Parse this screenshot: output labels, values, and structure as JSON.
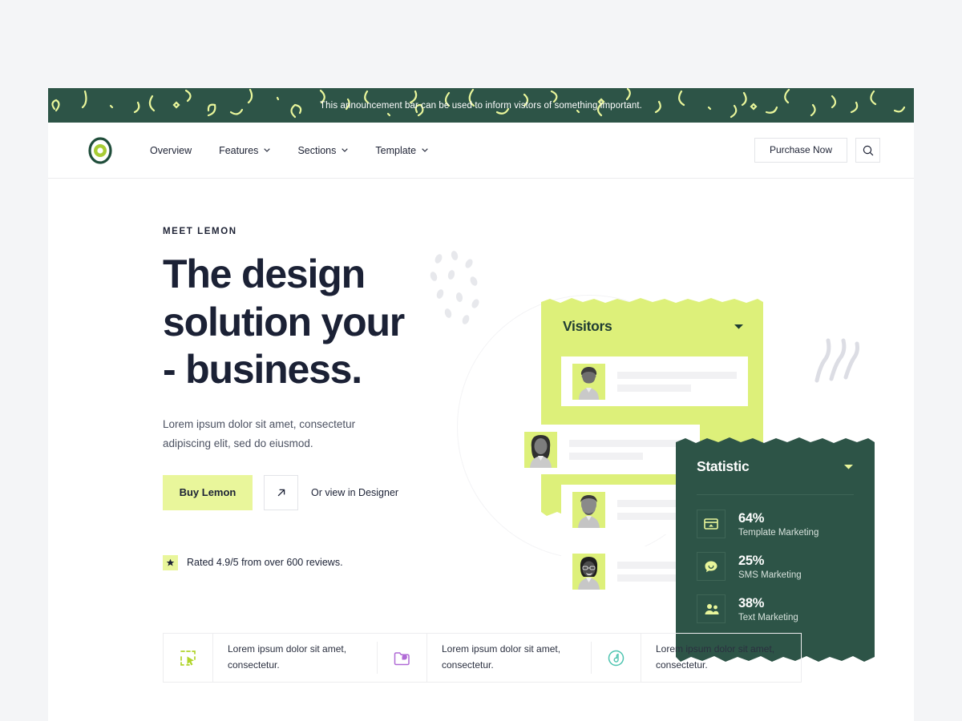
{
  "announcement": {
    "text": "This announcement bar can be used to inform vistors of something important."
  },
  "nav": {
    "logo_icon": "lemon-circle-logo",
    "links": [
      {
        "label": "Overview",
        "has_chevron": false
      },
      {
        "label": "Features",
        "has_chevron": true
      },
      {
        "label": "Sections",
        "has_chevron": true
      },
      {
        "label": "Template",
        "has_chevron": true
      }
    ],
    "purchase_label": "Purchase Now",
    "search_icon": "search-icon"
  },
  "hero": {
    "eyebrow": "MEET LEMON",
    "headline_line1": "The design",
    "headline_line2": "solution your",
    "headline_line3": "- business.",
    "subtext": "Lorem ipsum dolor sit amet, consectetur adipiscing elit, sed do eiusmod.",
    "buy_label": "Buy Lemon",
    "arrow_icon": "arrow-up-right-icon",
    "designer_link": "Or view in Designer",
    "star_icon": "star-icon",
    "rating_text": "Rated 4.9/5 from over 600 reviews."
  },
  "visitors_card": {
    "title": "Visitors",
    "chevron_icon": "chevron-down-icon",
    "rows": [
      {
        "avatar": "portrait-person-1"
      },
      {
        "avatar": "portrait-person-2"
      },
      {
        "avatar": "portrait-person-3"
      },
      {
        "avatar": "portrait-person-4"
      }
    ]
  },
  "statistic_card": {
    "title": "Statistic",
    "chevron_icon": "chevron-down-icon",
    "items": [
      {
        "percent": "64%",
        "label": "Template Marketing",
        "icon": "browser-window-icon"
      },
      {
        "percent": "25%",
        "label": "SMS Marketing",
        "icon": "chat-bubble-icon"
      },
      {
        "percent": "38%",
        "label": "Text Marketing",
        "icon": "users-group-icon"
      }
    ]
  },
  "features": [
    {
      "icon": "selection-cursor-icon",
      "text": "Lorem ipsum dolor sit amet, consectetur."
    },
    {
      "icon": "folder-icon",
      "text": "Lorem ipsum dolor sit amet, consectetur."
    },
    {
      "icon": "gauge-icon",
      "text": "Lorem ipsum dolor sit amet, consectetur."
    }
  ],
  "colors": {
    "dark_green": "#2d5447",
    "lime": "#ddf07a",
    "lime_light": "#e9f69b",
    "navy": "#1b2135",
    "page_bg": "#f4f5f7"
  }
}
